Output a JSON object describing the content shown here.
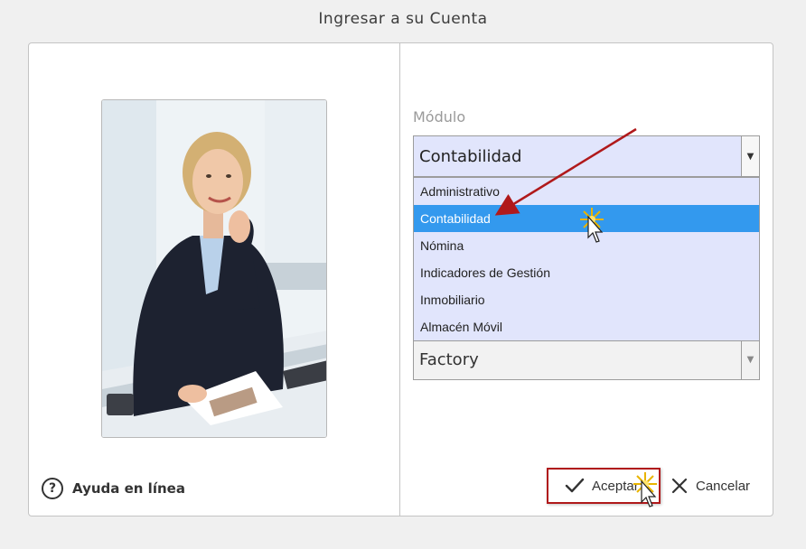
{
  "window": {
    "title": "Ingresar a su Cuenta"
  },
  "help": {
    "label": "Ayuda en línea",
    "icon": "question-circle-icon"
  },
  "module": {
    "label": "Módulo",
    "selected": "Contabilidad",
    "options": [
      "Administrativo",
      "Contabilidad",
      "Nómina",
      "Indicadores de Gestión",
      "Inmobiliario",
      "Almacén Móvil"
    ],
    "highlighted_index": 1
  },
  "company": {
    "selected": "Factory"
  },
  "buttons": {
    "accept": {
      "label": "Aceptar",
      "icon": "checkmark-icon"
    },
    "cancel": {
      "label": "Cancelar",
      "icon": "close-icon"
    }
  },
  "colors": {
    "highlight": "#3399ee",
    "annotation": "#b0191b",
    "dropdown_bg": "#e1e5fc"
  }
}
